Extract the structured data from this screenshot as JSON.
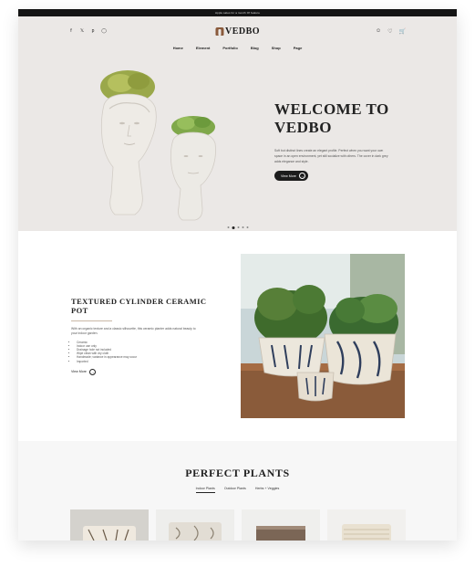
{
  "topbar": {
    "text": "Apple sales for a month Of feature"
  },
  "header": {
    "social_icons": [
      "facebook-icon",
      "twitter-icon",
      "pinterest-icon",
      "instagram-icon"
    ],
    "logo": "VEDBO",
    "nav": [
      "Home",
      "Element",
      "Portfolio",
      "Blog",
      "Shop",
      "Page"
    ],
    "action_icons": [
      "user-icon",
      "heart-icon",
      "cart-icon"
    ]
  },
  "hero": {
    "title": "WELCOME TO VEDBO",
    "description": "Soft but distinct lines create an elegant profile. Perfect when you want your own space in an open environment, yet still socialize with others. The cover in dark grey adds elegance and style.",
    "button": "View More",
    "slides": 5,
    "active_slide": 2
  },
  "feature": {
    "title": "TEXTURED CYLINDER CERAMIC POT",
    "description": "With an organic texture and a classic silhouette, this ceramic planter adds natural beauty to your indoor garden.",
    "list": [
      "Ceramic",
      "Indoor use only",
      "Drainage hole not included",
      "Wipe clean with dry cloth",
      "Handmade; variance in appearance may occur",
      "Imported"
    ],
    "link": "View More"
  },
  "plants": {
    "title": "PERFECT PLANTS",
    "tabs": [
      "Indoor Plants",
      "Outdoor Plants",
      "Herbs + Veggies"
    ],
    "active_tab": 0
  },
  "colors": {
    "hero_bg": "#ebe8e6",
    "dark": "#1c1c1c",
    "accent": "#8a5a3c",
    "plants_bg": "#f7f7f7"
  }
}
